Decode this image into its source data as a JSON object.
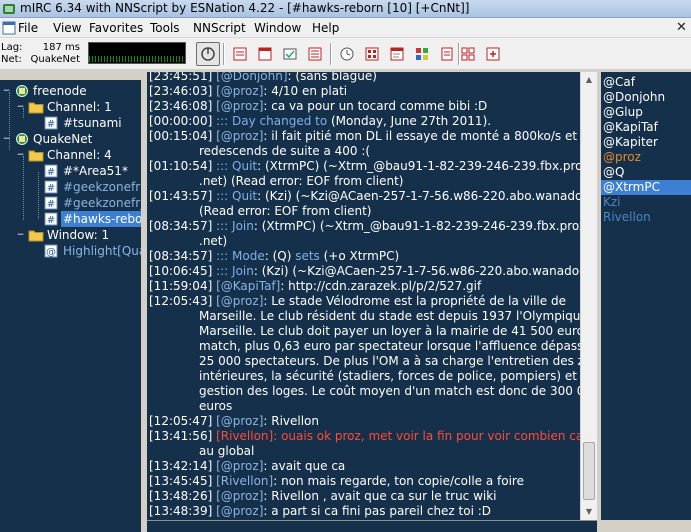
{
  "window": {
    "title": "mIRC 6.34 with NNScript by ESNation 4.22 - [#hawks-reborn [10] [+CnNt]]"
  },
  "menu": {
    "items": [
      "File",
      "View",
      "Favorites",
      "Tools",
      "NNScript",
      "Window",
      "Help"
    ],
    "close": "✕"
  },
  "toolbar": {
    "lag_label": "Lag:",
    "lag_value": "187 ms",
    "net_label": "Net:",
    "net_value": "QuakeNet",
    "buttons": [
      {
        "icon": "connect-icon",
        "active": true
      },
      {
        "icon": "options-icon",
        "active": false
      },
      {
        "icon": "address-book-icon",
        "active": false
      },
      {
        "icon": "notify-icon",
        "active": false
      },
      {
        "icon": "channels-list-icon",
        "active": false
      },
      {
        "icon": "url-catcher-icon",
        "active": false
      },
      {
        "icon": "timer-icon",
        "active": false
      },
      {
        "icon": "scripts-editor-icon",
        "active": false
      },
      {
        "icon": "colors-icon",
        "active": false
      },
      {
        "icon": "notes-icon",
        "active": false
      },
      {
        "icon": "tile-windows-icon",
        "active": false
      },
      {
        "icon": "help-icon",
        "active": false
      }
    ]
  },
  "tree": {
    "nodes": [
      {
        "label": "freenode",
        "type": "network",
        "expander": "−",
        "color": "#ffffff"
      },
      {
        "label": "Channel: 1",
        "type": "folder",
        "expander": "−",
        "color": "#ffffff"
      },
      {
        "label": "#tsunami",
        "type": "channel",
        "color": "#ffffff"
      },
      {
        "label": "QuakeNet",
        "type": "network",
        "expander": "−",
        "color": "#ffffff"
      },
      {
        "label": "Channel: 4",
        "type": "folder",
        "expander": "−",
        "color": "#ffffff"
      },
      {
        "label": "#*Area51*",
        "type": "channel",
        "color": "#ffffff"
      },
      {
        "label": "#geekzonefr",
        "type": "channel",
        "color": "#8db4e0"
      },
      {
        "label": "#geekzonefr_",
        "type": "channel",
        "color": "#8db4e0"
      },
      {
        "label": "#hawks-reborn",
        "type": "channel",
        "color": "#ffffff",
        "selected": true
      },
      {
        "label": "Window: 1",
        "type": "folder",
        "expander": "−",
        "color": "#ffffff"
      },
      {
        "label": "Highlight[Qua",
        "type": "window",
        "color": "#8db4e0"
      }
    ]
  },
  "chat": {
    "lines": [
      {
        "ts": "[23:45:51]",
        "parts": [
          {
            "t": " [@Donjohn]",
            "c": "nick"
          },
          {
            "t": ": (sans blague)",
            "c": "txt"
          }
        ]
      },
      {
        "ts": "[23:46:03]",
        "parts": [
          {
            "t": " [@proz]",
            "c": "nick"
          },
          {
            "t": ": 4/10 en plati",
            "c": "txt"
          }
        ]
      },
      {
        "ts": "[23:46:08]",
        "parts": [
          {
            "t": " [@proz]",
            "c": "nick"
          },
          {
            "t": ": ca va pour un tocard comme bibi :D",
            "c": "txt"
          }
        ]
      },
      {
        "ts": "[00:00:00]",
        "parts": [
          {
            "t": " ::: Day changed to ",
            "c": "info"
          },
          {
            "t": "(Monday, June 27th 2011).",
            "c": "txt"
          }
        ]
      },
      {
        "ts": "[00:15:04]",
        "parts": [
          {
            "t": " [@proz]",
            "c": "nick"
          },
          {
            "t": ": il fait pitié mon DL il essaye de monté a 800ko/s et",
            "c": "txt"
          }
        ],
        "cont": [
          "redescends de suite a 400 :("
        ]
      },
      {
        "ts": "[01:10:54]",
        "parts": [
          {
            "t": " ::: ",
            "c": "info"
          },
          {
            "t": "Quit",
            "c": "info"
          },
          {
            "t": ": (XtrmPC) (~Xtrm_@bau91-1-82-239-246-239.fbx.proxad",
            "c": "txt"
          }
        ],
        "cont": [
          ".net) (Read error: EOF from client)"
        ]
      },
      {
        "ts": "[01:43:57]",
        "parts": [
          {
            "t": " ::: ",
            "c": "info"
          },
          {
            "t": "Quit",
            "c": "info"
          },
          {
            "t": ": (Kzi) (~Kzi@ACaen-257-1-7-56.w86-220.abo.wanadoo.fr)",
            "c": "txt"
          }
        ],
        "cont": [
          "(Read error: EOF from client)"
        ]
      },
      {
        "ts": "[08:34:57]",
        "parts": [
          {
            "t": " ::: ",
            "c": "info"
          },
          {
            "t": "Join",
            "c": "info"
          },
          {
            "t": ": (XtrmPC) (~Xtrm_@bau91-1-82-239-246-239.fbx.proxad",
            "c": "txt"
          }
        ],
        "cont": [
          ".net)"
        ]
      },
      {
        "ts": "[08:34:57]",
        "parts": [
          {
            "t": " ::: Mode",
            "c": "info"
          },
          {
            "t": ": (Q) ",
            "c": "txt"
          },
          {
            "t": "sets",
            "c": "info"
          },
          {
            "t": " (+o XtrmPC)",
            "c": "txt"
          }
        ]
      },
      {
        "ts": "[10:06:45]",
        "parts": [
          {
            "t": " ::: ",
            "c": "info"
          },
          {
            "t": "Join",
            "c": "info"
          },
          {
            "t": ": (Kzi) (~Kzi@ACaen-257-1-7-56.w86-220.abo.wanadoo.fr)",
            "c": "txt"
          }
        ]
      },
      {
        "ts": "[11:59:04]",
        "parts": [
          {
            "t": " [@KapiTaf]",
            "c": "nick"
          },
          {
            "t": ": http://cdn.zarazek.pl/p/2/527.gif",
            "c": "txt"
          }
        ]
      },
      {
        "ts": "[12:05:43]",
        "parts": [
          {
            "t": " [@proz]",
            "c": "nick"
          },
          {
            "t": ": Le stade Vélodrome est la propriété de la ville de",
            "c": "txt"
          }
        ],
        "cont": [
          "Marseille. Le club résident du stade est depuis 1937 l'Olympique de",
          "Marseille. Le club doit payer un loyer à la mairie de 41 500 euros par",
          "match, plus 0,63 euro par spectateur lorsque l'affluence dépasse les",
          "25 000 spectateurs. De plus l'OM a à sa charge l'entretien des zones",
          "intérieures, la sécurité (stadiers, forces de police, pompiers) et la",
          "gestion des loges. Le coût moyen d'un match est donc de 300 000",
          "euros"
        ]
      },
      {
        "ts": "[12:05:47]",
        "parts": [
          {
            "t": " [@proz]",
            "c": "nick"
          },
          {
            "t": ": Rivellon",
            "c": "txt"
          }
        ]
      },
      {
        "ts": "[13:41:56]",
        "parts": [
          {
            "t": " [Rivellon]",
            "c": "red"
          },
          {
            "t": ": ouais ok proz, met voir la fin pour voir combien ca fait",
            "c": "red"
          }
        ],
        "cont_color": "red",
        "cont": [
          "au global"
        ]
      },
      {
        "ts": "[13:42:14]",
        "parts": [
          {
            "t": " [@proz]",
            "c": "nick"
          },
          {
            "t": ": avait que ca",
            "c": "txt"
          }
        ]
      },
      {
        "ts": "[13:45:45]",
        "parts": [
          {
            "t": " [Rivellon]",
            "c": "nick"
          },
          {
            "t": ": non mais regarde, ton copie/colle a foire",
            "c": "txt"
          }
        ]
      },
      {
        "ts": "[13:48:26]",
        "parts": [
          {
            "t": " [@proz]",
            "c": "nick"
          },
          {
            "t": ": Rivellon , avait que ca sur le truc wiki",
            "c": "txt"
          }
        ]
      },
      {
        "ts": "[13:48:39]",
        "parts": [
          {
            "t": " [@proz]",
            "c": "nick"
          },
          {
            "t": ": a part si ca fini pas pareil chez toi :D",
            "c": "txt"
          }
        ]
      }
    ]
  },
  "nicklist": {
    "nicks": [
      {
        "name": "@Caf",
        "color": "#ffffff"
      },
      {
        "name": "@Donjohn",
        "color": "#ffffff"
      },
      {
        "name": "@Glup",
        "color": "#ffffff"
      },
      {
        "name": "@KapiTaf",
        "color": "#ffffff"
      },
      {
        "name": "@Kapiter",
        "color": "#ffffff"
      },
      {
        "name": "@proz",
        "color": "#e98a2a"
      },
      {
        "name": "@Q",
        "color": "#ffffff"
      },
      {
        "name": "@XtrmPC",
        "color": "#ffffff",
        "selected": true
      },
      {
        "name": "Kzi",
        "color": "#4f86c0"
      },
      {
        "name": "Rivellon",
        "color": "#4f86c0"
      }
    ]
  },
  "colors": {
    "background": "#14304a",
    "selection": "#3c7fd3",
    "nick": "#8db4e0",
    "highlight": "#ff4a3a",
    "op_self": "#e98a2a"
  }
}
